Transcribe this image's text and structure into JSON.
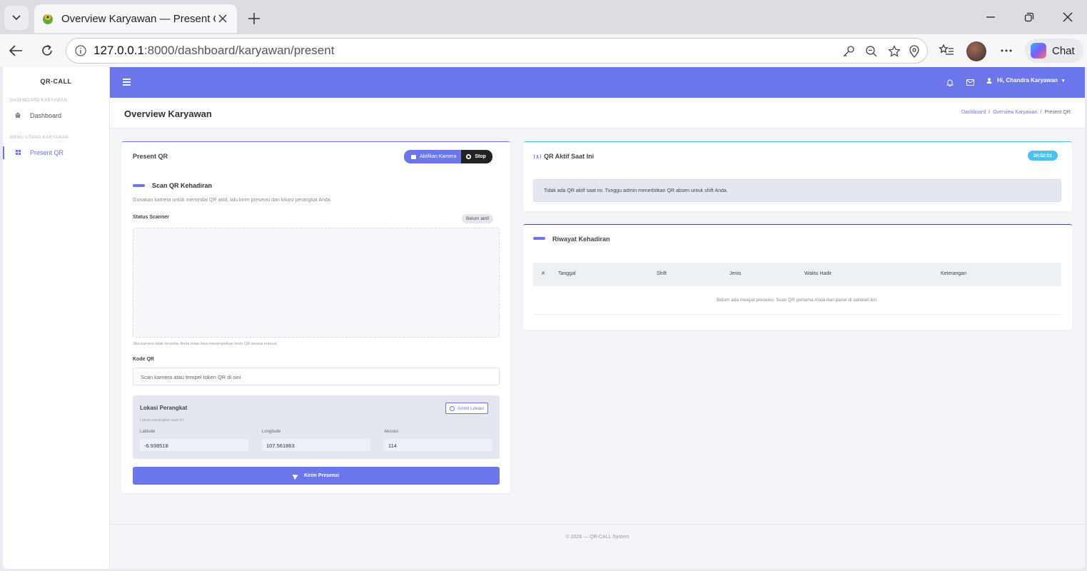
{
  "browser": {
    "tab_title": "Overview Karyawan — Present QR",
    "url_host": "127.0.0.1",
    "url_rest": ":8000/dashboard/karyawan/present",
    "chat_label": "Chat"
  },
  "sidebar": {
    "brand": "QR-CALL",
    "sections": [
      {
        "title": "DASHBOARD KARYAWAN",
        "items": [
          {
            "label": "Dashboard",
            "icon": "home-icon"
          }
        ]
      },
      {
        "title": "MENU UTAMA KARYAWAN",
        "items": [
          {
            "label": "Present QR",
            "icon": "grid-icon",
            "active": true
          }
        ]
      }
    ]
  },
  "topnav": {
    "user_label": "Hi, Chandra Karyawan",
    "accent": "#6a76ea"
  },
  "page": {
    "title": "Overview Karyawan",
    "breadcrumb": [
      "Dashboard",
      "Overview Karyawan",
      "Present QR"
    ]
  },
  "present_card": {
    "title": "Present QR",
    "camera_button": "Aktifkan Kamera",
    "stop_button": "Stop",
    "scan_heading": "Scan QR Kehadiran",
    "scan_desc": "Gunakan kamera untuk memindai QR aktif, lalu kirim presensi dari lokasi perangkat Anda.",
    "status_label": "Status Scanner",
    "status_badge": "Belum aktif",
    "camera_hint": "Jika kamera tidak tersedia, Anda tetap bisa menempelkan kode QR secara manual.",
    "code_label": "Kode QR",
    "code_placeholder": "Scan kamera atau tempel token QR di sini",
    "location": {
      "title": "Lokasi Perangkat",
      "subtitle": "Lokasi perangkat saat ini.",
      "button": "Ambil Lokasi",
      "latitude_label": "Latitude",
      "latitude": "-6.938518",
      "longitude_label": "Longitude",
      "longitude": "107.561863",
      "accuracy_label": "Akurasi",
      "accuracy": "114"
    },
    "submit": "Kirim Presensi"
  },
  "qr_card": {
    "title": "QR Aktif Saat Ini",
    "time": "20:52:01",
    "alert": "Tidak ada QR aktif saat ini. Tunggu admin menerbitkan QR absen untuk shift Anda.",
    "accent": "#4ac2ea"
  },
  "history_card": {
    "title": "Riwayat Kehadiran",
    "columns": [
      "#",
      "Tanggal",
      "Shift",
      "Jenis",
      "Waktu Hadir",
      "Keterangan"
    ],
    "empty": "Belum ada riwayat presensi. Scan QR pertama Anda dari panel di sebelah kiri."
  },
  "footer": "© 2026 — QR-CALL System"
}
